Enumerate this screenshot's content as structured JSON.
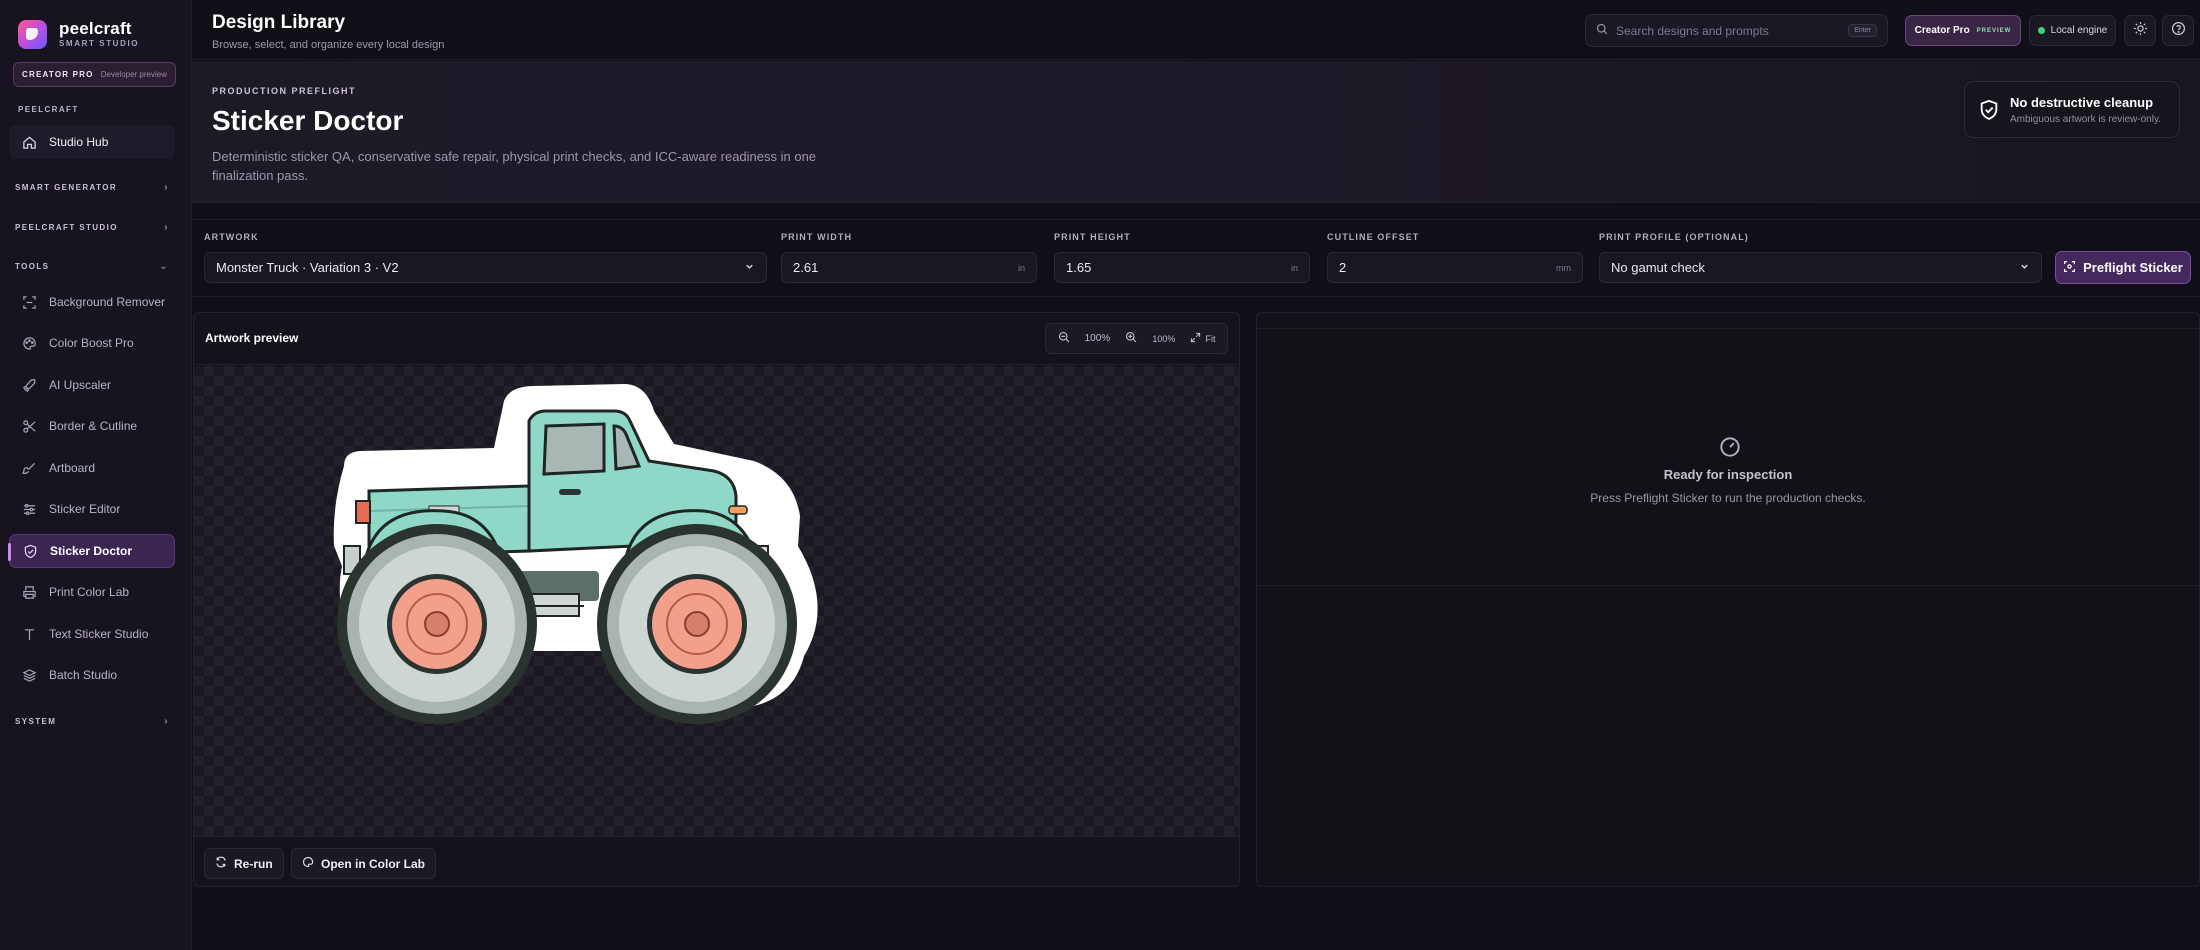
{
  "brand": {
    "name": "peelcraft",
    "sub": "SMART STUDIO"
  },
  "plan": {
    "name": "CREATOR PRO",
    "note": "Developer preview"
  },
  "sidebar": {
    "group_label": "PEELCRAFT",
    "hub": "Studio Hub",
    "sections": {
      "smart_generator": "SMART GENERATOR",
      "peelcraft_studio": "PEELCRAFT STUDIO",
      "tools": "TOOLS",
      "system": "SYSTEM"
    },
    "tools": [
      {
        "label": "Background Remover",
        "icon": "scan-icon"
      },
      {
        "label": "Color Boost Pro",
        "icon": "palette-icon"
      },
      {
        "label": "AI Upscaler",
        "icon": "rocket-icon"
      },
      {
        "label": "Border & Cutline",
        "icon": "scissors-icon"
      },
      {
        "label": "Artboard",
        "icon": "brush-icon"
      },
      {
        "label": "Sticker Editor",
        "icon": "sliders-icon"
      },
      {
        "label": "Sticker Doctor",
        "icon": "shield-check-icon",
        "active": true
      },
      {
        "label": "Print Color Lab",
        "icon": "printer-icon"
      },
      {
        "label": "Text Sticker Studio",
        "icon": "text-icon"
      },
      {
        "label": "Batch Studio",
        "icon": "layers-icon"
      }
    ]
  },
  "header": {
    "title": "Design Library",
    "subtitle": "Browse, select, and organize every local design",
    "search_placeholder": "Search designs and prompts",
    "search_shortcut": "Enter",
    "pro_label": "Creator Pro",
    "pro_badge": "PREVIEW",
    "engine_label": "Local engine"
  },
  "hero": {
    "eyebrow": "PRODUCTION PREFLIGHT",
    "title": "Sticker Doctor",
    "description": "Deterministic sticker QA, conservative safe repair, physical print checks, and ICC-aware readiness in one finalization pass.",
    "badge_title": "No destructive cleanup",
    "badge_sub": "Ambiguous artwork is review-only."
  },
  "controls": {
    "artwork_label": "ARTWORK",
    "artwork_value": "Monster Truck · Variation 3 · V2",
    "width_label": "PRINT WIDTH",
    "width_value": "2.61",
    "width_unit": "in",
    "height_label": "PRINT HEIGHT",
    "height_value": "1.65",
    "height_unit": "in",
    "offset_label": "CUTLINE OFFSET",
    "offset_value": "2",
    "offset_unit": "mm",
    "profile_label": "PRINT PROFILE (OPTIONAL)",
    "profile_value": "No gamut check",
    "preflight_button": "Preflight Sticker"
  },
  "preview": {
    "title": "Artwork preview",
    "zoom_value": "100%",
    "zoom_preset": "100%",
    "fit_label": "Fit",
    "rerun_button": "Re-run",
    "color_lab_button": "Open in Color Lab"
  },
  "result": {
    "title": "Ready for inspection",
    "subtitle": "Press Preflight Sticker to run the production checks."
  },
  "colors": {
    "accent": "#7a4ea0",
    "active_nav": "#3a2650",
    "truck_body": "#8fd7c6",
    "wheel_hub": "#f2a08c",
    "engine_dot": "#3fd17a"
  }
}
